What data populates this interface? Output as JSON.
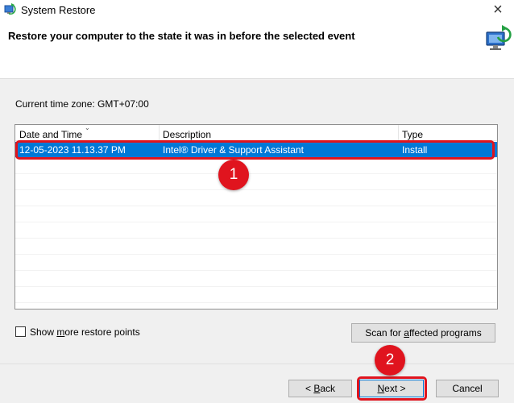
{
  "window": {
    "title": "System Restore",
    "close_glyph": "×"
  },
  "header": {
    "heading": "Restore your computer to the state it was in before the selected event"
  },
  "timezone": {
    "label": "Current time zone: GMT+07:00"
  },
  "restore_list": {
    "columns": [
      "Date and Time",
      "Description",
      "Type"
    ],
    "rows": [
      {
        "date_time": "12-05-2023 11.13.37 PM",
        "description": "Intel® Driver & Support Assistant",
        "type": "Install",
        "selected": true
      }
    ]
  },
  "options": {
    "show_more_pre": "Show ",
    "show_more_key": "m",
    "show_more_post": "ore restore points",
    "checked": false
  },
  "buttons": {
    "scan_pre": "Scan for ",
    "scan_key": "a",
    "scan_post": "ffected programs",
    "back_pre": "< ",
    "back_key": "B",
    "back_post": "ack",
    "next_key": "N",
    "next_post": "ext >",
    "cancel": "Cancel"
  },
  "annotations": {
    "step1": "1",
    "step2": "2",
    "color": "#e0141e"
  },
  "icons": [
    "system-restore-icon",
    "close-icon",
    "monitor-restore-icon",
    "sort-caret-icon",
    "checkbox"
  ],
  "colors": {
    "selection": "#0078d7",
    "primary_border": "#0078d7"
  }
}
